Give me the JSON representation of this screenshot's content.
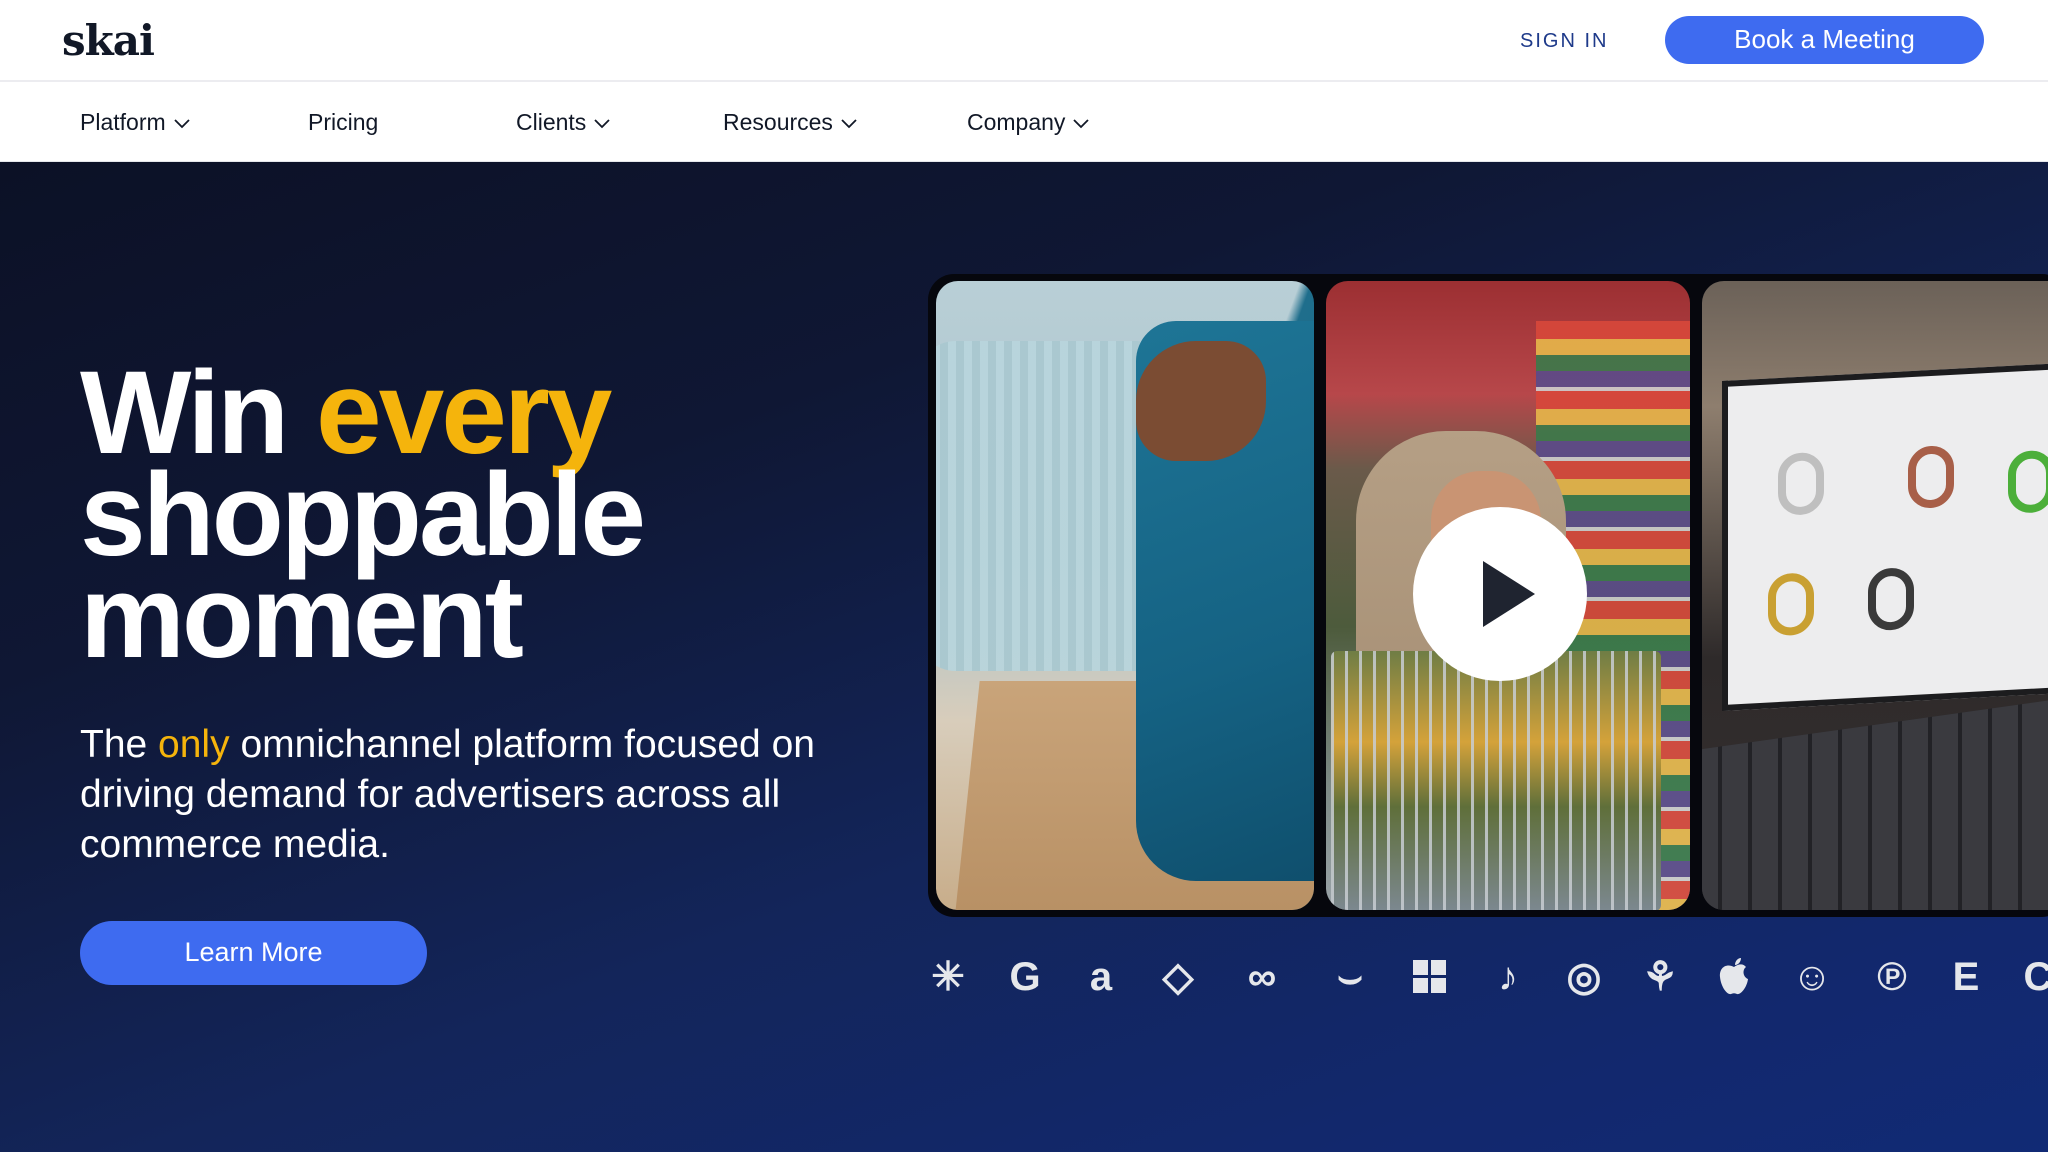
{
  "brand": {
    "logo_text": "skai"
  },
  "header": {
    "sign_in": "SIGN IN",
    "cta": "Book a Meeting"
  },
  "nav": {
    "items": [
      {
        "label": "Platform",
        "has_dropdown": true
      },
      {
        "label": "Pricing",
        "has_dropdown": false
      },
      {
        "label": "Clients",
        "has_dropdown": true
      },
      {
        "label": "Resources",
        "has_dropdown": true
      },
      {
        "label": "Company",
        "has_dropdown": true
      }
    ]
  },
  "hero": {
    "headline_line1_a": "Win",
    "headline_line1_b": "every",
    "headline_line2": "shoppable",
    "headline_line3": "moment",
    "sub_a": "The",
    "sub_b": "only",
    "sub_c": "omnichannel platform focused on driving demand for advertisers across all commerce media.",
    "cta": "Learn More"
  },
  "media": {
    "play_icon": "play-icon"
  },
  "partners": {
    "icons": [
      "walmart-spark-icon",
      "google-icon",
      "amazon-icon",
      "criteo-icon",
      "meta-icon",
      "instacart-icon",
      "microsoft-icon",
      "tiktok-icon",
      "target-icon",
      "kroger-icon",
      "apple-icon",
      "snapchat-icon",
      "pinterest-icon",
      "etsy-icon",
      "c-icon"
    ],
    "glyphs": [
      "✳",
      "G",
      "a",
      "◇",
      "∞",
      "⌣",
      "",
      "♪",
      "◎",
      "⚘",
      "",
      "☺",
      "℗",
      "E",
      "C"
    ]
  },
  "colors": {
    "accent_yellow": "#f5b40c",
    "primary_blue": "#3e6bf0",
    "hero_dark": "#0c1126",
    "hero_blue": "#12286d"
  }
}
